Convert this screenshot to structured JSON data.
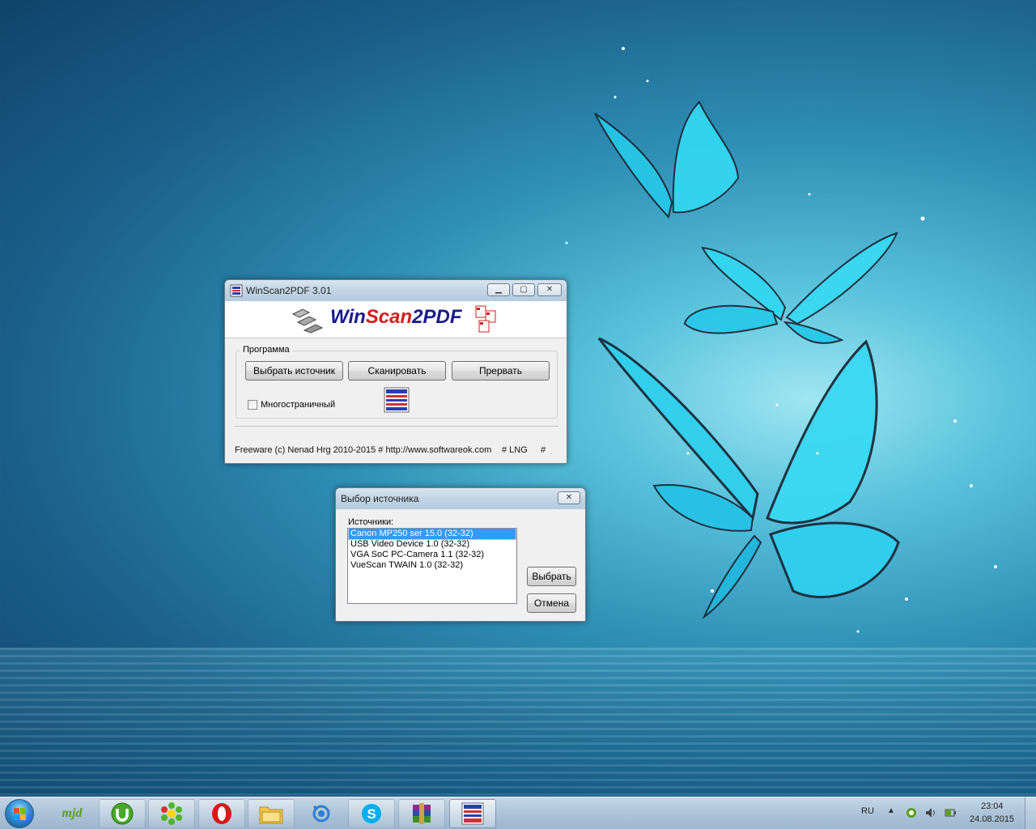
{
  "main_window": {
    "title": "WinScan2PDF 3.01",
    "logo_part1": "Win",
    "logo_part2": "Scan",
    "logo_part3": "2PDF",
    "group_label": "Программа",
    "buttons": {
      "select_source": "Выбрать источник",
      "scan": "Сканировать",
      "abort": "Прервать"
    },
    "multipage_label": "Многостраничный",
    "footer_text": "Freeware (c) Nenad Hrg 2010-2015 # http://www.softwareok.com",
    "footer_lng": "# LNG",
    "footer_hash": "#"
  },
  "source_dialog": {
    "title": "Выбор источника",
    "sources_label": "Источники:",
    "sources": [
      "Canon MP250 ser 15.0 (32-32)",
      "USB Video Device 1.0 (32-32)",
      "VGA SoC PC-Camera 1.1 (32-32)",
      "VueScan TWAIN 1.0 (32-32)"
    ],
    "selected_index": 0,
    "select_button": "Выбрать",
    "cancel_button": "Отмена"
  },
  "taskbar": {
    "apps": [
      {
        "icon": "mydocs-icon",
        "label": "mjd"
      },
      {
        "icon": "utorrent-icon"
      },
      {
        "icon": "icq-icon"
      },
      {
        "icon": "opera-icon"
      },
      {
        "icon": "folder-icon"
      },
      {
        "icon": "magnifier-app-icon"
      },
      {
        "icon": "skype-icon"
      },
      {
        "icon": "winrar-icon"
      },
      {
        "icon": "winscan2pdf-icon"
      }
    ],
    "tray_language": "RU",
    "tray_up_arrow": "▲",
    "clock_time": "23:04",
    "clock_date": "24.08.2015"
  },
  "colors": {
    "accent_selection": "#3399ff",
    "logo_blue": "#1a1a8c",
    "logo_red": "#d31f1f"
  }
}
